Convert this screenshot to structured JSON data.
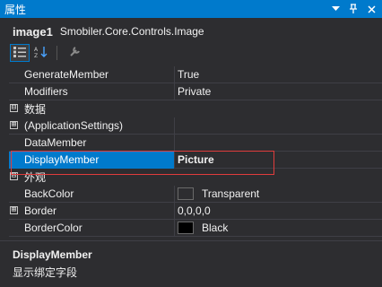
{
  "window": {
    "title": "属性",
    "controls": [
      "dropdown-icon",
      "pin-icon",
      "close-icon"
    ]
  },
  "object": {
    "name": "image1",
    "type": "Smobiler.Core.Controls.Image"
  },
  "toolbar": {
    "buttons": [
      "categorized-icon",
      "alphabetical-icon",
      "property-pages-icon"
    ]
  },
  "grid": {
    "rows": [
      {
        "kind": "prop",
        "name": "GenerateMember",
        "value": "True"
      },
      {
        "kind": "prop",
        "name": "Modifiers",
        "value": "Private"
      },
      {
        "kind": "category",
        "name": "数据",
        "expander": "⊟"
      },
      {
        "kind": "prop",
        "name": "(ApplicationSettings)",
        "value": "",
        "expander": "⊞"
      },
      {
        "kind": "prop",
        "name": "DataMember",
        "value": ""
      },
      {
        "kind": "prop",
        "name": "DisplayMember",
        "value": "Picture",
        "selected": true
      },
      {
        "kind": "category",
        "name": "外观",
        "expander": "⊟"
      },
      {
        "kind": "prop",
        "name": "BackColor",
        "value": "Transparent",
        "swatch": "#2d2d30"
      },
      {
        "kind": "prop",
        "name": "Border",
        "value": "0,0,0,0",
        "expander": "⊞"
      },
      {
        "kind": "prop",
        "name": "BorderColor",
        "value": "Black",
        "swatch": "#000000"
      }
    ]
  },
  "description": {
    "title": "DisplayMember",
    "text": "显示绑定字段"
  },
  "colors": {
    "accent": "#007acc",
    "highlight_border": "#e03c3c",
    "background": "#2d2d30"
  }
}
